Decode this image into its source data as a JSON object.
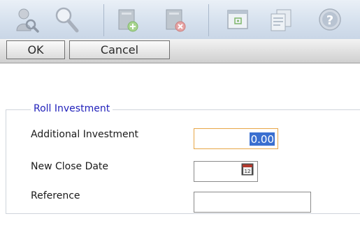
{
  "toolbar": {
    "icons": [
      "search-user-icon",
      "magnifier-icon",
      "add-document-icon",
      "delete-document-icon",
      "open-window-icon",
      "document-list-icon",
      "help-icon"
    ]
  },
  "actions": {
    "ok_label": "OK",
    "cancel_label": "Cancel"
  },
  "form": {
    "legend": "Roll Investment",
    "additional_investment": {
      "label": "Additional Investment",
      "value": "0.00"
    },
    "new_close_date": {
      "label": "New Close Date",
      "value": ""
    },
    "reference": {
      "label": "Reference",
      "value": ""
    }
  },
  "colors": {
    "legend": "#2222bb",
    "selection": "#3a6fd0",
    "focus_border": "#e7a646"
  }
}
